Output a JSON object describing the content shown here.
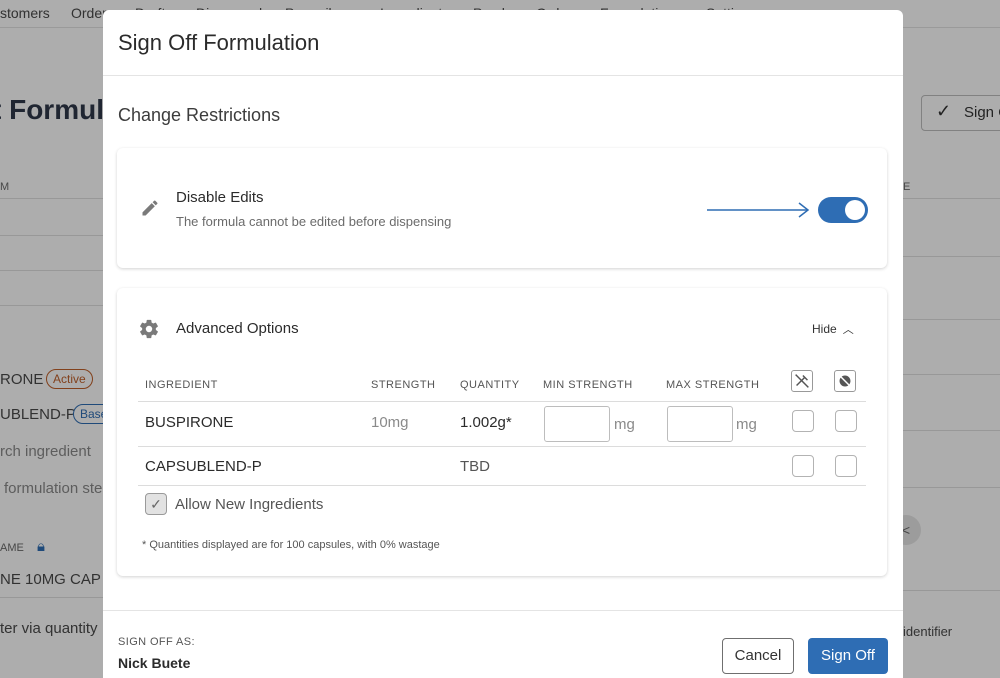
{
  "background": {
    "nav": [
      "stomers",
      "Orders",
      "Drafts",
      "Dispensed",
      "Prescribers",
      "Ingredients",
      "Purchase Orders",
      "Formulations",
      "Settings"
    ],
    "title": "t Formul",
    "sign_button": "Sign O",
    "col_m": "M",
    "col_e": "E",
    "ingredient_1": "RONE",
    "badge_active": "Active",
    "ingredient_2": "UBLEND-P",
    "badge_base": "Base",
    "search_placeholder": "rch ingredient",
    "formulation_step": "formulation ste",
    "name_label": "AME",
    "product_name": "NE 10MG CAP",
    "filter_text": "ter via quantity",
    "identifier": "identifier",
    "circle": "<"
  },
  "modal": {
    "title": "Sign Off Formulation",
    "section_title": "Change Restrictions",
    "disable_edits": {
      "label": "Disable Edits",
      "description": "The formula cannot be edited before dispensing",
      "enabled": true,
      "toggle_color": "#2e6db4"
    },
    "advanced": {
      "label": "Advanced Options",
      "hide_label": "Hide",
      "columns": [
        "INGREDIENT",
        "STRENGTH",
        "QUANTITY",
        "MIN STRENGTH",
        "MAX STRENGTH"
      ],
      "rows": [
        {
          "ingredient": "BUSPIRONE",
          "strength": "10mg",
          "quantity": "1.002g*",
          "min_unit": "mg",
          "max_unit": "mg"
        },
        {
          "ingredient": "CAPSUBLEND-P",
          "strength": "",
          "quantity": "TBD"
        }
      ],
      "allow_new_ingredients": "Allow New Ingredients",
      "footnote": "* Quantities displayed are for 100 capsules, with 0% wastage"
    },
    "footer": {
      "sign_off_as_label": "SIGN OFF AS:",
      "user_name": "Nick Buete",
      "cancel": "Cancel",
      "sign_off": "Sign Off"
    }
  }
}
